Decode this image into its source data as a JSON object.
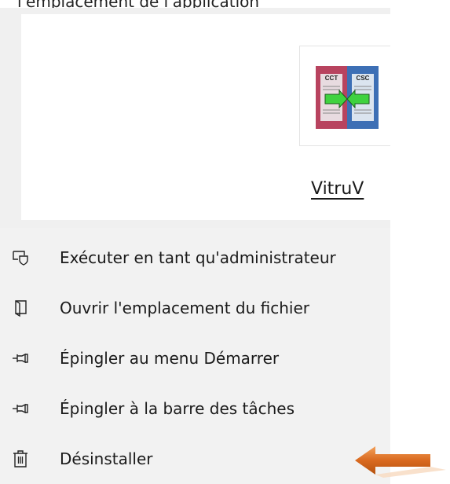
{
  "top_caption": "l'emplacement de l'application",
  "app": {
    "name": "VitruV",
    "icon": "app-icon-cct-csc",
    "icon_labels": [
      "CCT",
      "CSC"
    ]
  },
  "menu": {
    "items": [
      {
        "label": "Exécuter en tant qu'administrateur",
        "icon": "run-as-admin-icon"
      },
      {
        "label": "Ouvrir l'emplacement du fichier",
        "icon": "open-file-location-icon"
      },
      {
        "label": "Épingler au menu Démarrer",
        "icon": "pin-icon"
      },
      {
        "label": "Épingler à la barre des tâches",
        "icon": "pin-icon"
      },
      {
        "label": "Désinstaller",
        "icon": "trash-icon"
      }
    ]
  },
  "colors": {
    "menu_bg": "#f2f2f2",
    "arrow_orange": "#e07b2e"
  }
}
